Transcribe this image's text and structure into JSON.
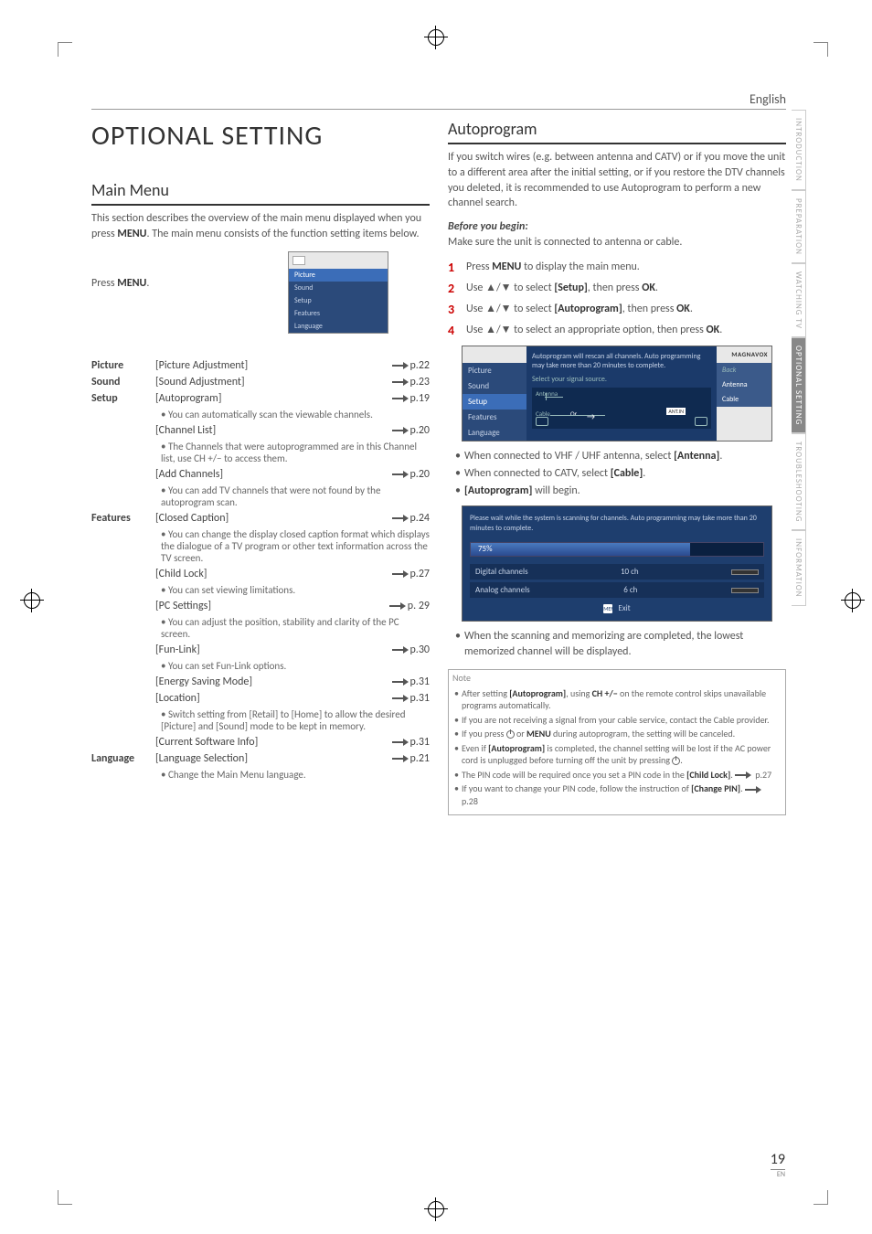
{
  "lang_header": "English",
  "title": "OPTIONAL SETTING",
  "main_menu": {
    "heading": "Main Menu",
    "intro": "This section describes the overview of the main menu displayed when you press MENU. The main menu consists of the function setting items below.",
    "press": "Press MENU.",
    "thumb": [
      "Picture",
      "Sound",
      "Setup",
      "Features",
      "Language"
    ]
  },
  "toc": {
    "categories": [
      {
        "cat": "Picture",
        "rows": [
          {
            "item": "[Picture Adjustment]",
            "pg": "p.22"
          }
        ]
      },
      {
        "cat": "Sound",
        "rows": [
          {
            "item": "[Sound Adjustment]",
            "pg": "p.23"
          }
        ]
      },
      {
        "cat": "Setup",
        "rows": [
          {
            "item": "[Autoprogram]",
            "pg": "p.19",
            "note": "• You can automatically scan the viewable channels."
          },
          {
            "item": "[Channel List]",
            "pg": "p.20",
            "note": "• The Channels that were autoprogrammed are in this Channel list, use CH +/− to access them."
          },
          {
            "item": "[Add Channels]",
            "pg": "p.20",
            "note": "• You can add TV channels that were not found by the autoprogram scan."
          }
        ]
      },
      {
        "cat": "Features",
        "rows": [
          {
            "item": "[Closed Caption]",
            "pg": "p.24",
            "note": "• You can change the display closed caption format which displays the dialogue of a TV program or other text information across the TV screen."
          },
          {
            "item": "[Child Lock]",
            "pg": "p.27",
            "note": "• You can set viewing limitations."
          },
          {
            "item": "[PC Settings]",
            "pg": "p. 29",
            "note": "• You can adjust the position, stability and clarity of the PC screen."
          },
          {
            "item": "[Fun-Link]",
            "pg": "p.30",
            "note": "• You can set Fun-Link options."
          },
          {
            "item": "[Energy Saving Mode]",
            "pg": "p.31"
          },
          {
            "item": "[Location]",
            "pg": "p.31",
            "note": "• Switch setting from [Retail] to [Home] to allow the desired [Picture] and [Sound] mode to be kept in memory."
          },
          {
            "item": "[Current Software Info]",
            "pg": "p.31"
          }
        ]
      },
      {
        "cat": "Language",
        "rows": [
          {
            "item": "[Language Selection]",
            "pg": "p.21",
            "note": "• Change the Main Menu language."
          }
        ]
      }
    ]
  },
  "autoprogram": {
    "heading": "Autoprogram",
    "intro": "If you switch wires (e.g. between antenna and CATV) or if you move the unit to a different area after the initial setting, or if you restore the DTV channels you deleted, it is recommended to use Autoprogram to perform a new channel search.",
    "before_label": "Before you begin:",
    "before_text": "Make sure the unit is connected to antenna or cable.",
    "steps": [
      "Press MENU to display the main menu.",
      "Use ▲/▼ to select [Setup], then press OK.",
      "Use ▲/▼ to select [Autoprogram], then press OK.",
      "Use ▲/▼ to select an appropriate option, then press OK."
    ],
    "scr1": {
      "side": [
        "Picture",
        "Sound",
        "Setup",
        "Features",
        "Language"
      ],
      "brand": "MAGNAVOX",
      "msg": "Autoprogram will rescan all channels. Auto programming may take more than 20 minutes to complete.",
      "sub": "Select your signal source.",
      "d_ant": "Antenna",
      "d_cable": "Cable",
      "d_or": "Or",
      "d_antin": "ANT.IN",
      "right": [
        "Back",
        "Antenna",
        "Cable"
      ]
    },
    "bullets1": [
      "When connected to VHF / UHF antenna, select [Antenna].",
      "When connected to CATV, select [Cable].",
      "[Autoprogram] will begin."
    ],
    "scr2": {
      "msg": "Please wait while the system is scanning for channels. Auto programming may take more than 20 minutes to complete.",
      "pct": "75%",
      "r1_label": "Digital channels",
      "r1_val": "10 ch",
      "r2_label": "Analog channels",
      "r2_val": "6 ch",
      "exit_icon": "MENU",
      "exit": "Exit"
    },
    "bullets2": [
      "When the scanning and memorizing are completed, the lowest memorized channel will be displayed."
    ]
  },
  "note": {
    "heading": "Note",
    "items_html": [
      "After setting <b>[Autoprogram]</b>, using <b>CH +/−</b> on the remote control skips unavailable programs automatically.",
      "If you are not receiving a signal from your cable service, contact the Cable provider.",
      "If you press <span class='pwr'></span> or <b>MENU</b> during autoprogram, the setting will be canceled.",
      "Even if <b>[Autoprogram]</b> is completed, the channel setting will be lost if the AC power cord is unplugged before turning off the unit by pressing <span class='pwr'></span>.",
      "The PIN code will be required once you set a PIN code in the <b>[Child Lock]</b>. <span class='arrow'></span> p.27",
      "If you want to change your PIN code, follow the instruction of <b>[Change PIN]</b>. <span class='arrow'></span> p.28"
    ]
  },
  "side_tabs": [
    "INTRODUCTION",
    "PREPARATION",
    "WATCHING TV",
    "OPTIONAL SETTING",
    "TROUBLESHOOTING",
    "INFORMATION"
  ],
  "page_number": "19",
  "page_number_sub": "EN"
}
